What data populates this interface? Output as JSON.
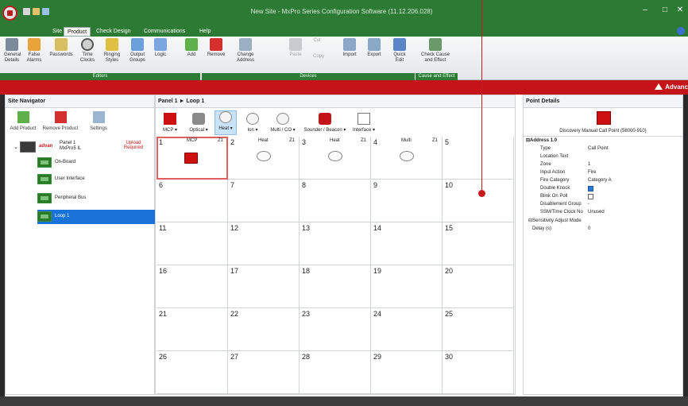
{
  "app": {
    "title": "New Site - MxPro Series Configuration Software (11.12.206.028)",
    "brand": "Advanc"
  },
  "tabs": [
    "Site",
    "Product",
    "Check Design",
    "Communications",
    "Help"
  ],
  "ribbon": {
    "editors": [
      "General Details",
      "False Alarms",
      "Passwords",
      "Time Clocks",
      "Ringing Styles",
      "Output Groups",
      "Logic"
    ],
    "devices": [
      "Add",
      "Remove",
      "Change Address",
      "Paste",
      "Cut",
      "Copy",
      "Import",
      "Export",
      "Quick Edit"
    ],
    "cause": [
      "Check Cause and Effect"
    ],
    "groups": [
      "Editors",
      "Devices",
      "Cause and Effect"
    ]
  },
  "site_navigator": {
    "title": "Site Navigator",
    "buttons": [
      "Add Product",
      "Remove Product",
      "Settings"
    ],
    "panel_name": "Panel 1",
    "panel_model": "MxPro5 IL",
    "panel_status": "Upload Required",
    "items": [
      "On-Board",
      "User Interface",
      "Peripheral Bus",
      "Loop 1"
    ]
  },
  "loop_view": {
    "breadcrumb": "Panel 1 ► Loop 1",
    "toolbar": [
      "MCP ▾",
      "Optical ▾",
      "Heat ▾",
      "Ion ▾",
      "Multi / CO ▾",
      "Sounder / Beacon ▾",
      "Interface ▾"
    ],
    "cells": [
      {
        "n": "1",
        "type": "MCP",
        "zone": "Z1"
      },
      {
        "n": "2",
        "type": "Heat",
        "zone": "Z1"
      },
      {
        "n": "3",
        "type": "Heat",
        "zone": "Z1"
      },
      {
        "n": "4",
        "type": "Multi",
        "zone": "Z1"
      },
      {
        "n": "5"
      },
      {
        "n": "6"
      },
      {
        "n": "7"
      },
      {
        "n": "8"
      },
      {
        "n": "9"
      },
      {
        "n": "10"
      },
      {
        "n": "11"
      },
      {
        "n": "12"
      },
      {
        "n": "13"
      },
      {
        "n": "14"
      },
      {
        "n": "15"
      },
      {
        "n": "16"
      },
      {
        "n": "17"
      },
      {
        "n": "18"
      },
      {
        "n": "19"
      },
      {
        "n": "20"
      },
      {
        "n": "21"
      },
      {
        "n": "22"
      },
      {
        "n": "23"
      },
      {
        "n": "24"
      },
      {
        "n": "25"
      },
      {
        "n": "26"
      },
      {
        "n": "27"
      },
      {
        "n": "28"
      },
      {
        "n": "29"
      },
      {
        "n": "30"
      }
    ]
  },
  "point_details": {
    "title": "Point Details",
    "device_caption": "Discovery Manual Call Point (58000-910)",
    "section": "Address 1.0",
    "rows": [
      {
        "k": "Type",
        "v": "Call Point"
      },
      {
        "k": "Location Text",
        "v": ""
      },
      {
        "k": "Zone",
        "v": "1"
      },
      {
        "k": "Input Action",
        "v": "Fire"
      },
      {
        "k": "Fire Category",
        "v": "Category A"
      },
      {
        "k": "Double Knock",
        "v": ""
      },
      {
        "k": "Blink On Poll",
        "v": ""
      },
      {
        "k": "Disablement Group",
        "v": "-"
      },
      {
        "k": "SSM/Time Clock No",
        "v": "Unused"
      },
      {
        "k": "⊟Sensitivity Adjust Mode",
        "v": ""
      },
      {
        "k": "Delay (s)",
        "v": "0"
      }
    ]
  },
  "colors": {
    "brand_green": "#2d7a34",
    "brand_red": "#c4141a",
    "selection_blue": "#1872d8"
  }
}
